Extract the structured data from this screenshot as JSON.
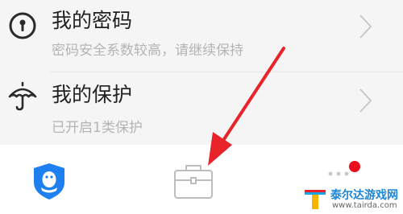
{
  "list": {
    "items": [
      {
        "icon": "key-hole-icon",
        "title": "我的密码",
        "subtitle": "密码安全系数较高，请继续保持"
      },
      {
        "icon": "umbrella-icon",
        "title": "我的保护",
        "subtitle": "已开启1类保护"
      }
    ]
  },
  "bottom_nav": {
    "tabs": [
      {
        "icon": "qq-shield-icon"
      },
      {
        "icon": "toolbox-icon"
      },
      {
        "icon": "more-dots-icon",
        "badge_color": "#e8101f"
      }
    ]
  },
  "annotation": {
    "arrow_color": "#e8232a"
  },
  "watermark": {
    "text": "泰尔达游戏网",
    "url": "www.tairda.com"
  },
  "colors": {
    "list_bg": "#f5f5f5",
    "brand_blue": "#1e7ff0",
    "watermark_blue": "#1c86d6"
  }
}
